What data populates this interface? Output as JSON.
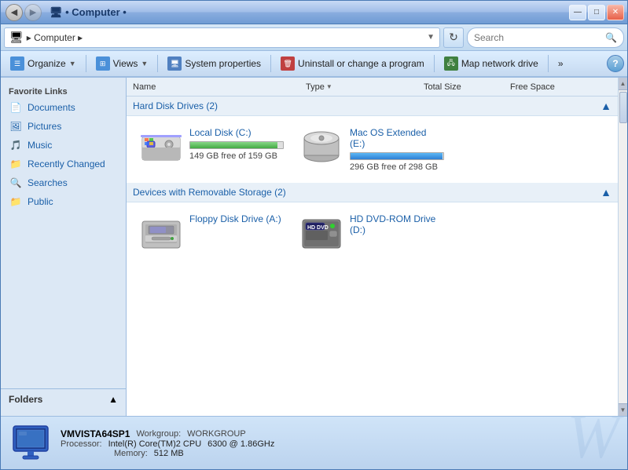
{
  "window": {
    "title": "Computer",
    "controls": {
      "minimize": "—",
      "maximize": "□",
      "close": "✕"
    }
  },
  "address_bar": {
    "path": "Computer",
    "breadcrumb_icon": "🖥",
    "separator": "▸",
    "search_placeholder": "Search",
    "refresh_symbol": "↻",
    "back_symbol": "◀",
    "nav_symbol": "◀▶"
  },
  "toolbar": {
    "organize_label": "Organize",
    "views_label": "Views",
    "system_properties_label": "System properties",
    "uninstall_label": "Uninstall or change a program",
    "map_drive_label": "Map network drive",
    "more_label": "»",
    "help_label": "?"
  },
  "sidebar": {
    "section_title": "Favorite Links",
    "items": [
      {
        "label": "Documents",
        "icon": "📄"
      },
      {
        "label": "Pictures",
        "icon": "🖼"
      },
      {
        "label": "Music",
        "icon": "♪"
      },
      {
        "label": "Recently Changed",
        "icon": "📁"
      },
      {
        "label": "Searches",
        "icon": "🔍"
      },
      {
        "label": "Public",
        "icon": "📁"
      }
    ],
    "folders_label": "Folders",
    "folders_arrow": "▲"
  },
  "columns": {
    "name": "Name",
    "type": "Type",
    "type_sort": "▼",
    "total_size": "Total Size",
    "free_space": "Free Space"
  },
  "hard_disks": {
    "section_title": "Hard Disk Drives (2)",
    "drives": [
      {
        "name": "Local Disk (C:)",
        "free_text": "149 GB free of 159 GB",
        "bar_class": "c",
        "icon": "💾"
      },
      {
        "name": "Mac OS Extended (E:)",
        "free_text": "296 GB free of 298 GB",
        "bar_class": "e",
        "icon": "💿"
      }
    ]
  },
  "removable": {
    "section_title": "Devices with Removable Storage (2)",
    "drives": [
      {
        "name": "Floppy Disk Drive (A:)",
        "icon": "floppy"
      },
      {
        "name": "HD DVD-ROM Drive (D:)",
        "icon": "hddvd"
      }
    ]
  },
  "status_bar": {
    "computer_name": "VMVISTA64SP1",
    "workgroup_label": "Workgroup:",
    "workgroup": "WORKGROUP",
    "processor_label": "Processor:",
    "processor": "Intel(R) Core(TM)2 CPU",
    "processor_speed": "6300  @ 1.86GHz",
    "memory_label": "Memory:",
    "memory": "512 MB"
  }
}
